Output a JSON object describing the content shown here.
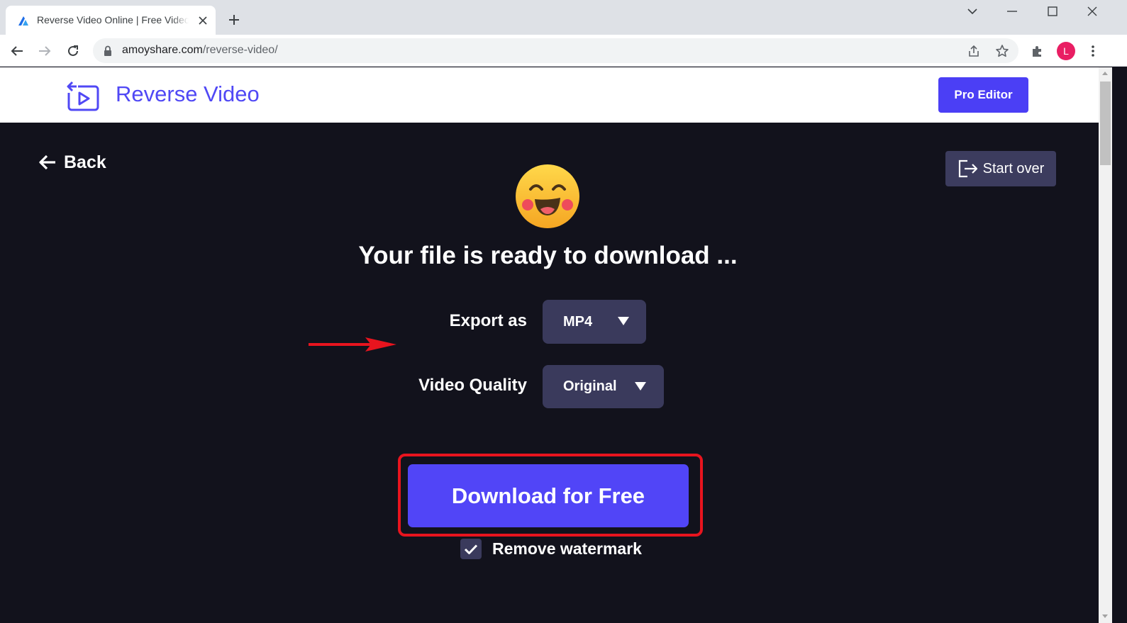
{
  "browser": {
    "tab_title": "Reverse Video Online | Free Video Reverser",
    "url_domain": "amoyshare.com",
    "url_path": "/reverse-video/",
    "profile_initial": "L"
  },
  "header": {
    "logo_text": "Reverse Video",
    "pro_editor_label": "Pro Editor"
  },
  "main": {
    "back_label": "Back",
    "start_over_label": "Start over",
    "title": "Your file is ready to download ...",
    "export_label": "Export as",
    "export_value": "MP4",
    "quality_label": "Video Quality",
    "quality_value": "Original",
    "download_label": "Download for Free",
    "watermark_label": "Remove watermark",
    "watermark_checked": true
  },
  "colors": {
    "brand": "#5048f5",
    "button": "#5145f7",
    "background": "#12121c",
    "select_bg": "#3a3a5c",
    "annotation": "#e8141e"
  },
  "icons": {
    "logo": "reverse-video-logo-icon",
    "emoji": "laughing-emoji-icon",
    "back": "arrow-left-icon",
    "start_over": "exit-icon"
  }
}
